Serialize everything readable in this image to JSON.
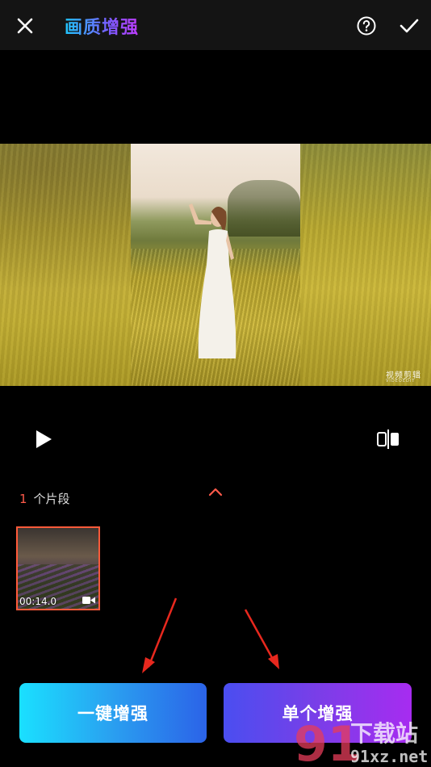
{
  "header": {
    "title": "画质增强",
    "close_icon": "close-icon",
    "help_icon": "help-circle-icon",
    "confirm_icon": "checkmark-icon"
  },
  "video": {
    "watermark_title": "视频剪辑",
    "watermark_sub": "VIDEOEDIT"
  },
  "controls": {
    "play_icon": "play-icon",
    "compare_icon": "compare-icon"
  },
  "segments": {
    "count": "1",
    "label": "个片段",
    "expand_icon": "chevron-up-icon"
  },
  "clips": [
    {
      "duration": "00:14.0",
      "type_icon": "video-camera-icon"
    }
  ],
  "actions": {
    "one_click_label": "一键增强",
    "single_label": "单个增强"
  },
  "overlay_watermark": {
    "text": "下载站",
    "domain": "91xz.net"
  },
  "colors": {
    "accent_red": "#ff5a4a",
    "btn_one_start": "#1ae0ff",
    "btn_one_end": "#2b63e8",
    "btn_single_start": "#4a4ef0",
    "btn_single_end": "#a72cf0",
    "annotation_arrow": "#e8281e"
  }
}
